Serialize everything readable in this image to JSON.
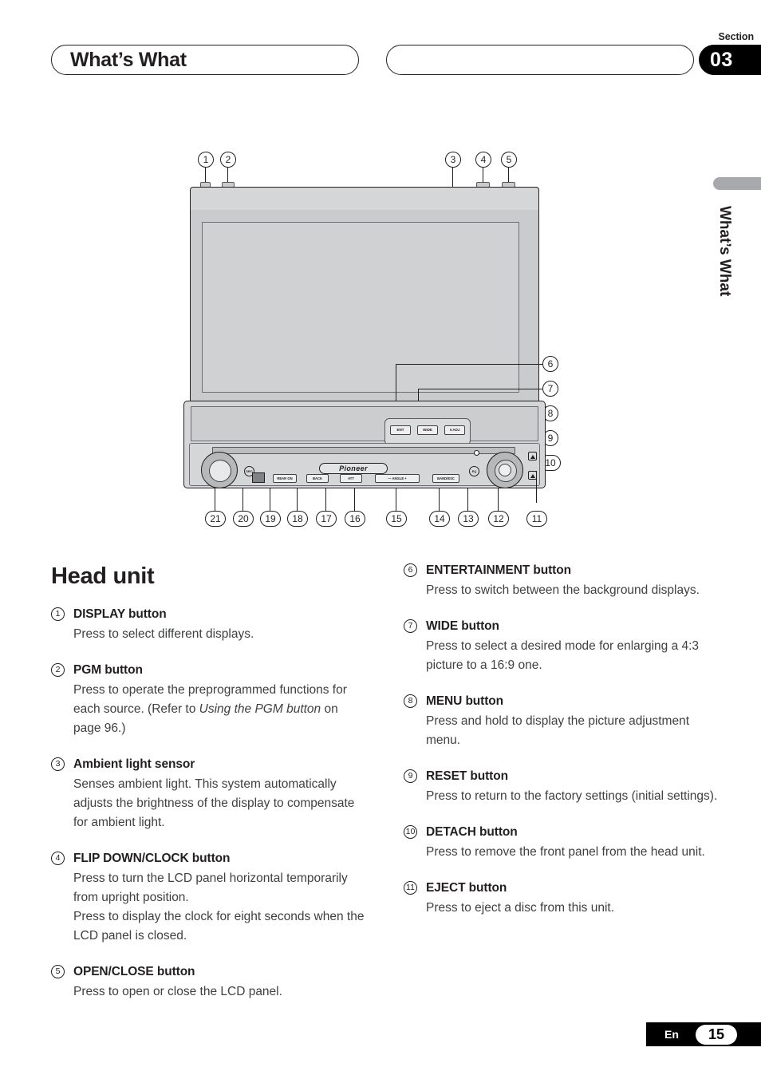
{
  "header": {
    "title": "What’s What",
    "section_word": "Section",
    "section_number": "03"
  },
  "side_tab": {
    "label": "What’s What"
  },
  "diagram": {
    "brand_logo": "Pioneer",
    "top_callouts": [
      "1",
      "2",
      "3",
      "4",
      "5"
    ],
    "right_callouts": [
      "6",
      "7",
      "8",
      "9",
      "10"
    ],
    "bottom_callouts": [
      "21",
      "20",
      "19",
      "18",
      "17",
      "16",
      "15",
      "14",
      "13",
      "12",
      "11"
    ],
    "cluster_buttons": [
      "ENT",
      "WIDE",
      "V.ADJ"
    ],
    "row_buttons": [
      "REAR ON",
      "BACK",
      "ATT",
      "—  ANGLE  +",
      "BAND/ESC"
    ],
    "knob_button_left": "SRC",
    "knob_button_right": "EQ"
  },
  "main": {
    "title": "Head unit",
    "left_entries": [
      {
        "num": "1",
        "label": "DISPLAY button",
        "body": "Press to select different displays."
      },
      {
        "num": "2",
        "label": "PGM button",
        "body_pre": "Press to operate the preprogrammed functions for each source. (Refer to ",
        "body_em": "Using the PGM button",
        "body_post": " on page 96.)"
      },
      {
        "num": "3",
        "label": "Ambient light sensor",
        "body": "Senses ambient light. This system automatically adjusts the brightness of the display to compensate for ambient light."
      },
      {
        "num": "4",
        "label": "FLIP DOWN/CLOCK button",
        "body": "Press to turn the LCD panel horizontal temporarily from upright position.\nPress to display the clock for eight seconds when the LCD panel is closed."
      },
      {
        "num": "5",
        "label": "OPEN/CLOSE button",
        "body": "Press to open or close the LCD panel."
      }
    ],
    "right_entries": [
      {
        "num": "6",
        "label": "ENTERTAINMENT button",
        "body": "Press to switch between the background displays."
      },
      {
        "num": "7",
        "label": "WIDE button",
        "body": "Press to select a desired mode for enlarging a 4:3 picture to a 16:9 one."
      },
      {
        "num": "8",
        "label": "MENU button",
        "body": "Press and hold to display the picture adjustment menu."
      },
      {
        "num": "9",
        "label": "RESET button",
        "body": "Press to return to the factory settings (initial settings)."
      },
      {
        "num": "10",
        "label": "DETACH button",
        "body": "Press to remove the front panel from the head unit."
      },
      {
        "num": "11",
        "label": "EJECT button",
        "body": "Press to eject a disc from this unit."
      }
    ]
  },
  "footer": {
    "language": "En",
    "page": "15"
  }
}
